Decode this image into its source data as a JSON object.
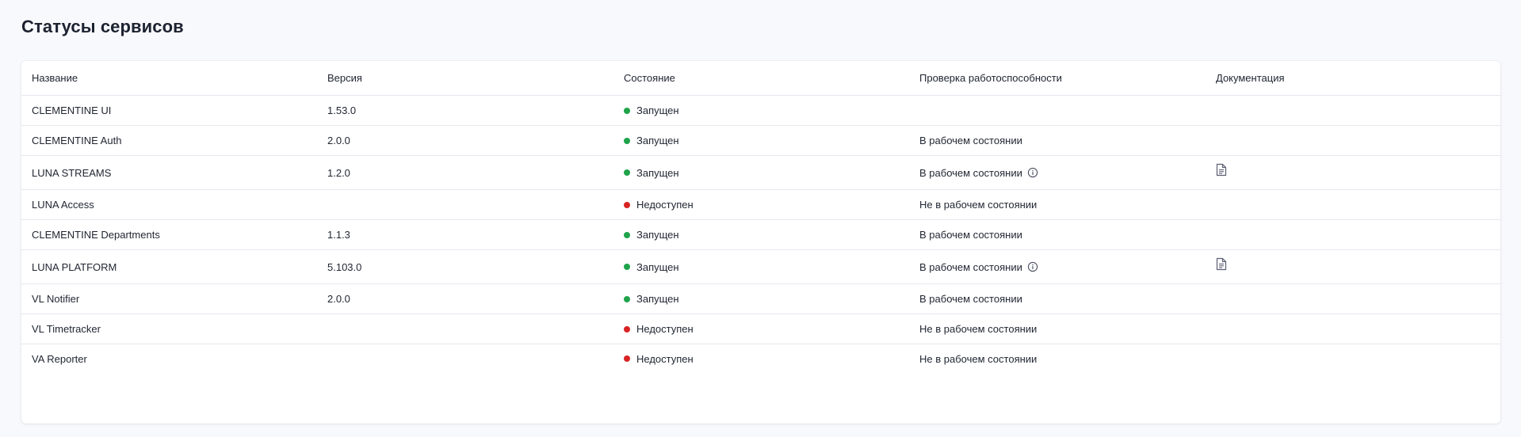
{
  "page": {
    "title": "Статусы сервисов"
  },
  "colors": {
    "running": "#1fa34a",
    "unavailable": "#d92323"
  },
  "table": {
    "headers": {
      "name": "Название",
      "version": "Версия",
      "state": "Состояние",
      "health": "Проверка работоспособности",
      "docs": "Документация"
    },
    "rows": [
      {
        "name": "CLEMENTINE UI",
        "version": "1.53.0",
        "state": "Запущен",
        "status": "running",
        "health": "",
        "health_info_icon": false,
        "docs_icon": false
      },
      {
        "name": "CLEMENTINE Auth",
        "version": "2.0.0",
        "state": "Запущен",
        "status": "running",
        "health": "В рабочем состоянии",
        "health_info_icon": false,
        "docs_icon": false
      },
      {
        "name": "LUNA STREAMS",
        "version": "1.2.0",
        "state": "Запущен",
        "status": "running",
        "health": "В рабочем состоянии",
        "health_info_icon": true,
        "docs_icon": true
      },
      {
        "name": "LUNA Access",
        "version": "",
        "state": "Недоступен",
        "status": "unavailable",
        "health": "Не в рабочем состоянии",
        "health_info_icon": false,
        "docs_icon": false
      },
      {
        "name": "CLEMENTINE Departments",
        "version": "1.1.3",
        "state": "Запущен",
        "status": "running",
        "health": "В рабочем состоянии",
        "health_info_icon": false,
        "docs_icon": false
      },
      {
        "name": "LUNA PLATFORM",
        "version": "5.103.0",
        "state": "Запущен",
        "status": "running",
        "health": "В рабочем состоянии",
        "health_info_icon": true,
        "docs_icon": true
      },
      {
        "name": "VL Notifier",
        "version": "2.0.0",
        "state": "Запущен",
        "status": "running",
        "health": "В рабочем состоянии",
        "health_info_icon": false,
        "docs_icon": false
      },
      {
        "name": "VL Timetracker",
        "version": "",
        "state": "Недоступен",
        "status": "unavailable",
        "health": "Не в рабочем состоянии",
        "health_info_icon": false,
        "docs_icon": false
      },
      {
        "name": "VA Reporter",
        "version": "",
        "state": "Недоступен",
        "status": "unavailable",
        "health": "Не в рабочем состоянии",
        "health_info_icon": false,
        "docs_icon": false
      }
    ]
  },
  "icons": {
    "info": "info-circle-icon",
    "docs": "document-icon"
  }
}
